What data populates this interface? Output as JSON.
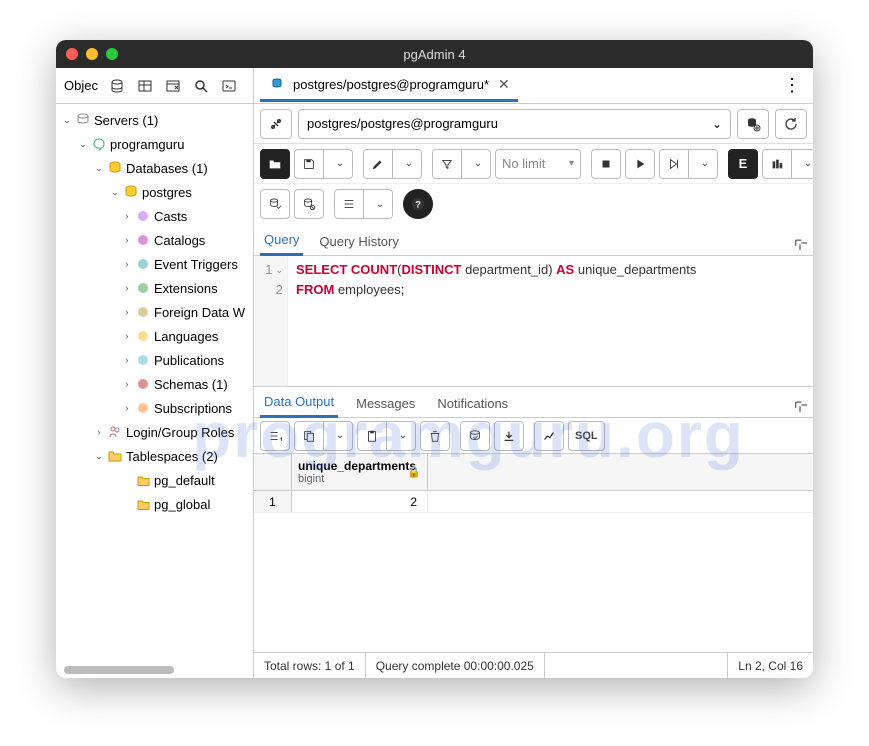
{
  "window": {
    "title": "pgAdmin 4"
  },
  "sidebar": {
    "label": "Objec",
    "tree": {
      "servers": "Servers (1)",
      "server_name": "programguru",
      "databases": "Databases (1)",
      "db_name": "postgres",
      "items": [
        "Casts",
        "Catalogs",
        "Event Triggers",
        "Extensions",
        "Foreign Data W",
        "Languages",
        "Publications",
        "Schemas (1)",
        "Subscriptions"
      ],
      "login_roles": "Login/Group Roles",
      "tablespaces": "Tablespaces (2)",
      "ts_items": [
        "pg_default",
        "pg_global"
      ]
    }
  },
  "tab": {
    "label": "postgres/postgres@programguru*"
  },
  "connection": {
    "value": "postgres/postgres@programguru"
  },
  "toolbar": {
    "nolimit": "No limit",
    "e_btn": "E",
    "sql_btn": "SQL"
  },
  "query_tabs": {
    "query": "Query",
    "history": "Query History"
  },
  "editor": {
    "line1_tokens": [
      "SELECT",
      " ",
      "COUNT",
      "(",
      "DISTINCT",
      " ",
      "department_id",
      ")",
      " ",
      "AS",
      " ",
      "unique_departments"
    ],
    "line2_tokens": [
      "FROM",
      " ",
      "employees",
      ";"
    ],
    "gutter": [
      "1",
      "2"
    ]
  },
  "output_tabs": {
    "data": "Data Output",
    "messages": "Messages",
    "notifications": "Notifications"
  },
  "result": {
    "column": {
      "name": "unique_departments",
      "type": "bigint"
    },
    "rows": [
      {
        "n": "1",
        "val": "2"
      }
    ]
  },
  "status": {
    "total": "Total rows: 1 of 1",
    "complete": "Query complete 00:00:00.025",
    "pos": "Ln 2, Col 16"
  },
  "watermark": "programguru.org"
}
